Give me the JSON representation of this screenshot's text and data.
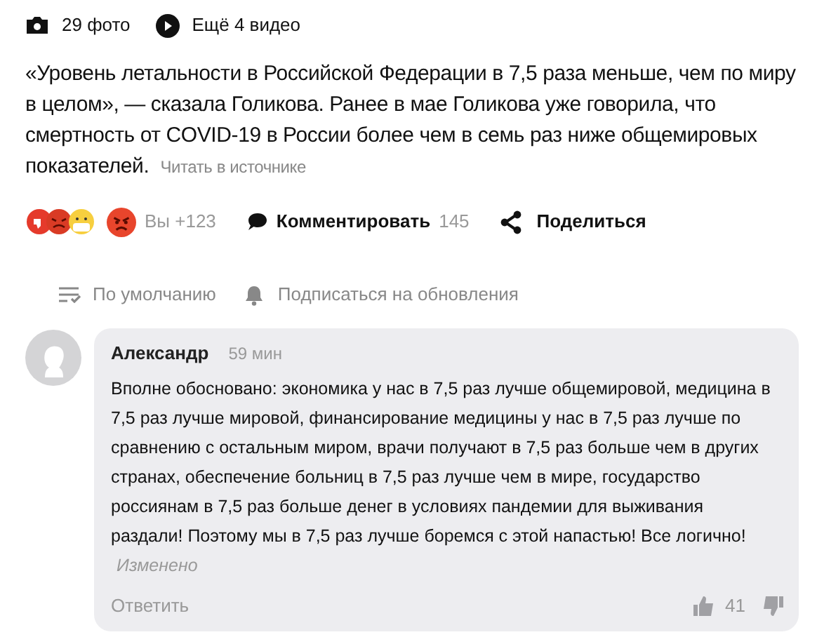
{
  "media": [
    {
      "kind": "photo",
      "label": "29 фото"
    },
    {
      "kind": "video",
      "label": "Ещё 4 видео"
    }
  ],
  "article": {
    "text": "«Уровень летальности в Российской Федерации в 7,5 раза меньше, чем по миру в целом», — сказала Голикова. Ранее в мае Голикова уже говорила, что смертность от COVID-19 в России более чем в семь раз ниже общемировых показателей.",
    "source_link": "Читать в источнике"
  },
  "reactions": {
    "count": "Вы +123",
    "comment_label": "Комментировать",
    "comment_count": "145",
    "share_label": "Поделиться"
  },
  "comments_toolbar": {
    "sort": "По умолчанию",
    "subscribe": "Подписаться на обновления"
  },
  "comments": [
    {
      "author": "Александр",
      "time": "59 мин",
      "text": "Вполне обосновано: экономика у нас в 7,5 раз лучше общемировой, медицина в 7,5 раз лучше мировой, финансирование медицины у нас в 7,5 раз лучше по сравнению с остальным миром, врачи получают в 7,5 раз больше чем в других странах, обеспечение больниц в 7,5 раз лучше чем в мире, государство россиянам в 7,5 раз больше денег в условиях пандемии для выживания раздали! Поэтому мы в 7,5 раз лучше боремся с этой напастью! Все логично!",
      "edited": "Изменено",
      "reply": "Ответить",
      "likes": "41"
    }
  ]
}
